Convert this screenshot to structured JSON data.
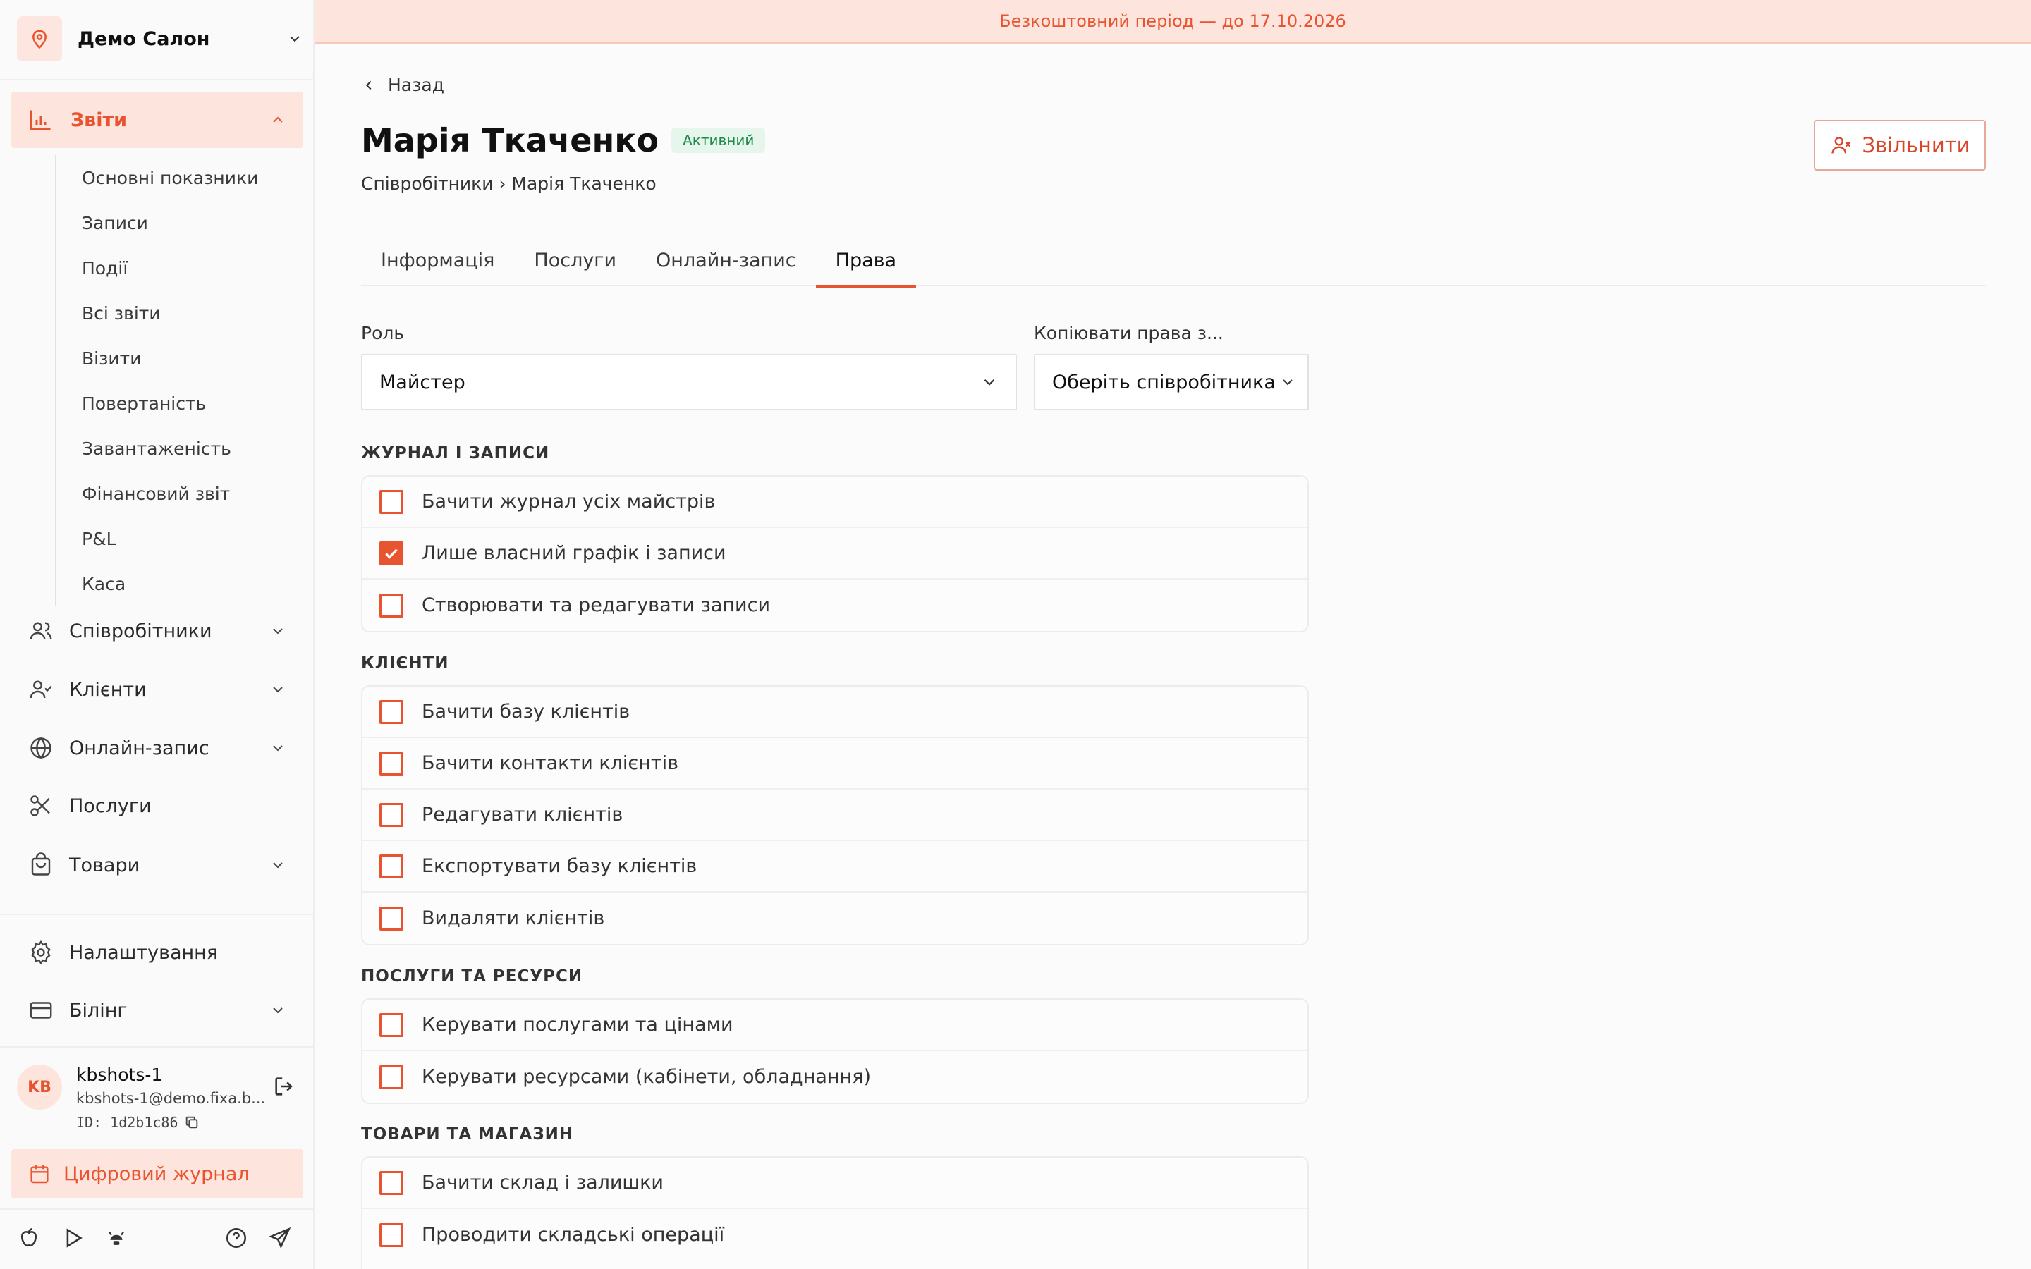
{
  "sidebar": {
    "brand_name": "Демо Салон",
    "reports_label": "Звіти",
    "report_items": [
      "Основні показники",
      "Записи",
      "Події",
      "Всі звіти",
      "Візити",
      "Повертаність",
      "Завантаженість",
      "Фінансовий звіт",
      "P&L",
      "Каса"
    ],
    "nav": {
      "employees": "Співробітники",
      "clients": "Клієнти",
      "online": "Онлайн-запис",
      "services": "Послуги",
      "products": "Товари",
      "settings": "Налаштування",
      "billing": "Білінг"
    },
    "user": {
      "initials": "KB",
      "name": "kbshots-1",
      "email": "kbshots-1@demo.fixa.b...",
      "id": "ID: 1d2b1c86"
    },
    "journal_label": "Цифровий журнал"
  },
  "banner": {
    "text": "Безкоштовний період — до 17.10.2026"
  },
  "header": {
    "back_label": "Назад",
    "title": "Марія Ткаченко",
    "status": "Активний",
    "breadcrumb": "Співробітники › Марія Ткаченко",
    "fire_label": "Звільнити"
  },
  "tabs": [
    "Інформація",
    "Послуги",
    "Онлайн-запис",
    "Права"
  ],
  "active_tab": "Права",
  "form": {
    "role_label": "Роль",
    "role_value": "Майстер",
    "copy_label": "Копіювати права з...",
    "copy_value": "Оберіть співробітника"
  },
  "sections": [
    {
      "title": "ЖУРНАЛ І ЗАПИСИ",
      "items": [
        {
          "label": "Бачити журнал усіх майстрів",
          "checked": false
        },
        {
          "label": "Лише власний графік і записи",
          "checked": true
        },
        {
          "label": "Створювати та редагувати записи",
          "checked": false
        }
      ]
    },
    {
      "title": "КЛІЄНТИ",
      "items": [
        {
          "label": "Бачити базу клієнтів",
          "checked": false
        },
        {
          "label": "Бачити контакти клієнтів",
          "checked": false
        },
        {
          "label": "Редагувати клієнтів",
          "checked": false
        },
        {
          "label": "Експортувати базу клієнтів",
          "checked": false
        },
        {
          "label": "Видаляти клієнтів",
          "checked": false
        }
      ]
    },
    {
      "title": "ПОСЛУГИ ТА РЕСУРСИ",
      "items": [
        {
          "label": "Керувати послугами та цінами",
          "checked": false
        },
        {
          "label": "Керувати ресурсами (кабінети, обладнання)",
          "checked": false
        }
      ]
    },
    {
      "title": "ТОВАРИ ТА МАГАЗИН",
      "items": [
        {
          "label": "Бачити склад і залишки",
          "checked": false
        },
        {
          "label": "Проводити складські операції",
          "checked": false
        }
      ]
    }
  ],
  "colors": {
    "accent": "#e8542f",
    "accent_soft": "#fde4dc"
  }
}
